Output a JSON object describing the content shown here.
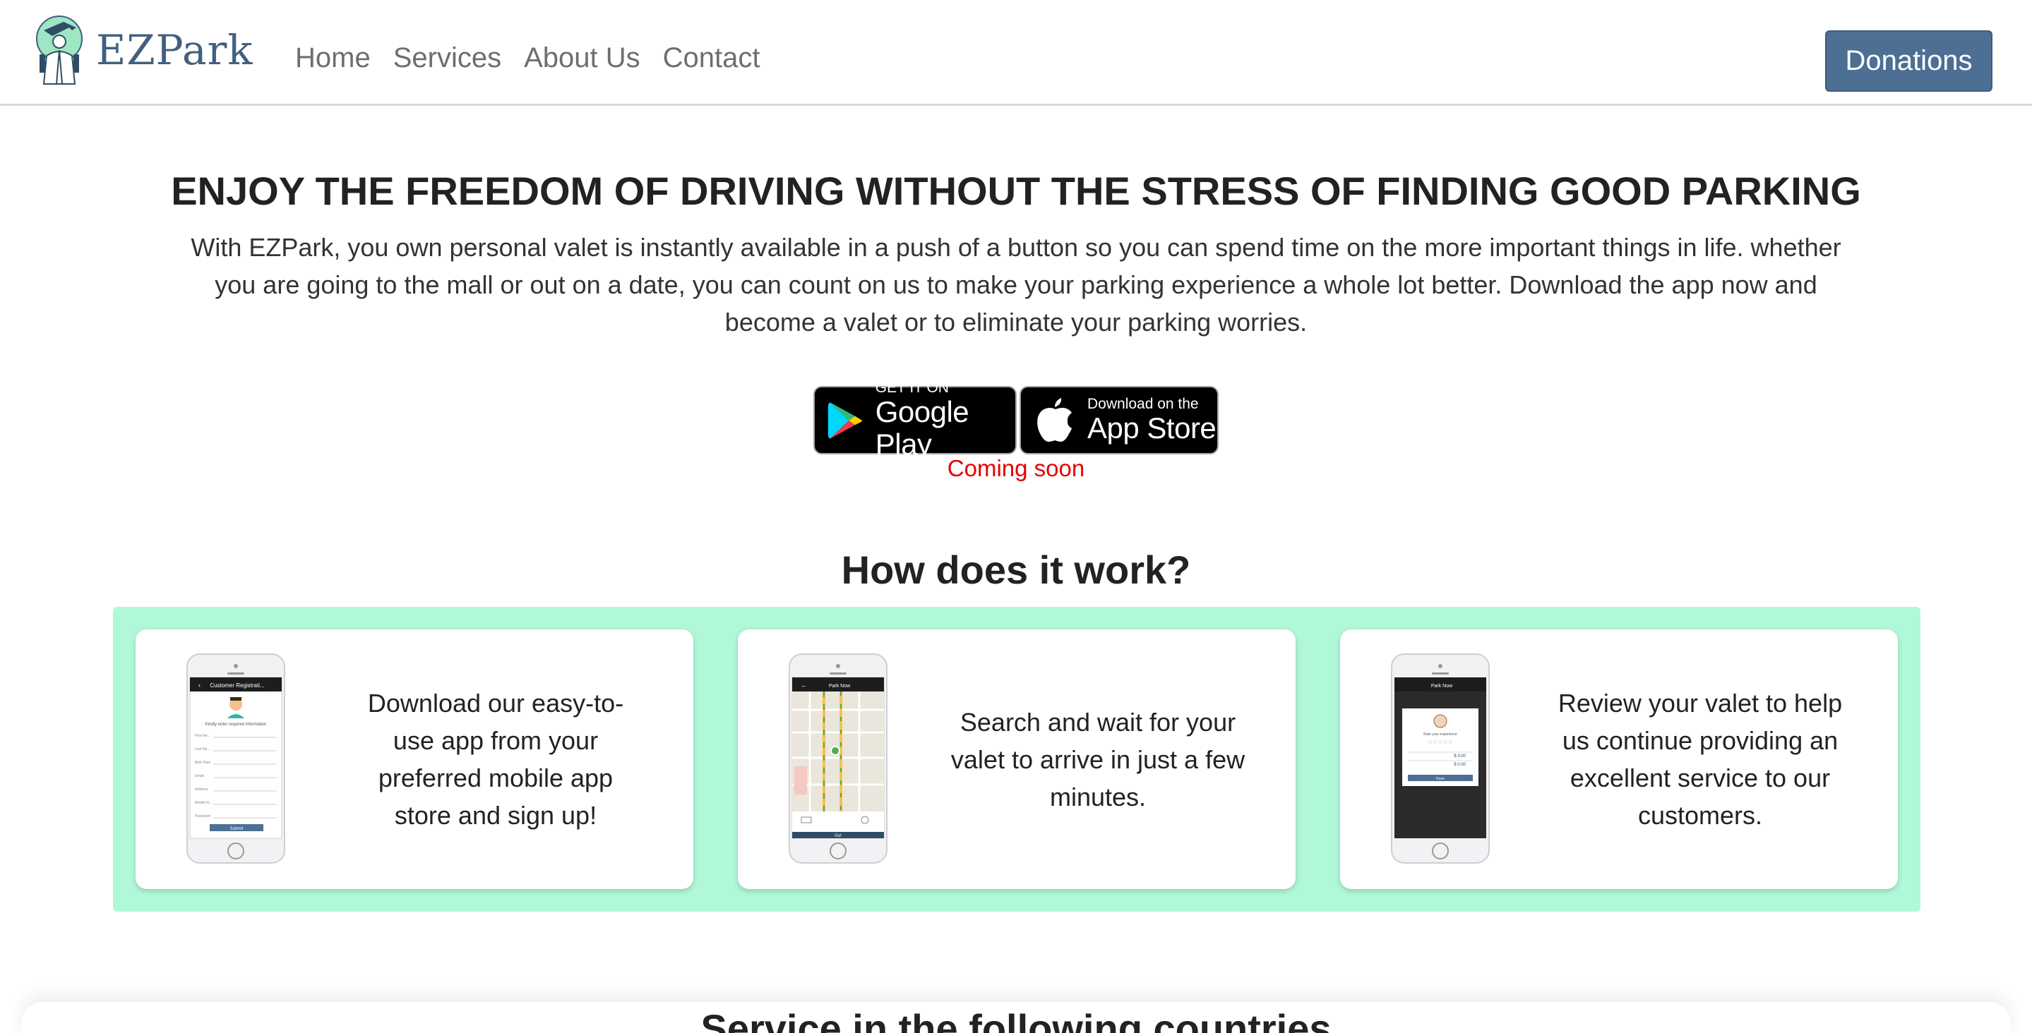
{
  "brand": {
    "name": "EZPark",
    "logo_icon": "valet-logo-icon",
    "color": "#41607e"
  },
  "nav": {
    "items": [
      "Home",
      "Services",
      "About Us",
      "Contact"
    ]
  },
  "donate": {
    "label": "Donations",
    "color": "#4c6f93"
  },
  "hero": {
    "title": "ENJOY THE FREEDOM OF DRIVING WITHOUT THE STRESS OF FINDING GOOD PARKING",
    "text": "With EZPark, you own personal valet is instantly available in a push of a button so you can spend time on the more important things in life. whether you are going to the mall or out on a date, you can count on us to make your parking experience a whole lot better. Download the app now and become a valet or to eliminate your parking worries."
  },
  "stores": {
    "google": {
      "small": "GET IT ON",
      "big": "Google Play",
      "icon": "google-play-icon"
    },
    "apple": {
      "small": "Download on the",
      "big": "App Store",
      "icon": "apple-icon"
    },
    "coming_soon": "Coming soon",
    "coming_soon_color": "#e60000"
  },
  "how": {
    "title": "How does it work?",
    "panel_color": "#b1f8d9",
    "cards": [
      {
        "text": "Download our easy-to-use app from your preferred mobile app store and sign up!",
        "phone": {
          "header": "Customer Registrati...",
          "subtitle": "Kindly enter required information",
          "fields": [
            "First Na...",
            "Last Na...",
            "Birth Date",
            "Email",
            "Address",
            "Mobile N...",
            "Password"
          ],
          "button": "Submit"
        }
      },
      {
        "text": "Search and wait for your valet to arrive in just a few minutes.",
        "phone": {
          "header": "Park Now",
          "button": "Go!"
        }
      },
      {
        "text": "Review your valet to help us continue providing an excellent service to our customers.",
        "phone": {
          "header": "Park Now",
          "subtitle": "Rate your experience",
          "price1": "$ 3.00",
          "price2": "$ 0.00",
          "button": "Done"
        }
      }
    ]
  },
  "countries": {
    "title": "Service in the following countries"
  }
}
